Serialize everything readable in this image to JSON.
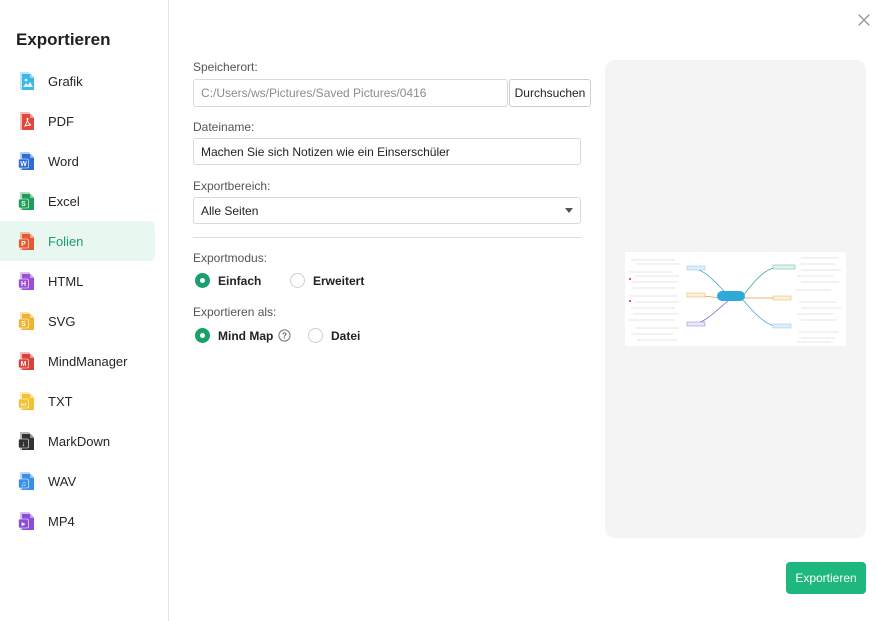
{
  "sidebar": {
    "title": "Exportieren",
    "items": [
      {
        "label": "Grafik",
        "icon": "image-file-icon",
        "color": "#3fb5e8",
        "letter": ""
      },
      {
        "label": "PDF",
        "icon": "pdf-file-icon",
        "color": "#e2453c",
        "letter": ""
      },
      {
        "label": "Word",
        "icon": "word-file-icon",
        "color": "#2f6bd6",
        "letter": "W"
      },
      {
        "label": "Excel",
        "icon": "excel-file-icon",
        "color": "#1f9d5a",
        "letter": "S"
      },
      {
        "label": "Folien",
        "icon": "slides-file-icon",
        "color": "#e8572e",
        "letter": "P"
      },
      {
        "label": "HTML",
        "icon": "html-file-icon",
        "color": "#9b4fd6",
        "letter": "H"
      },
      {
        "label": "SVG",
        "icon": "svg-file-icon",
        "color": "#f2b12e",
        "letter": "S"
      },
      {
        "label": "MindManager",
        "icon": "mindmanager-file-icon",
        "color": "#d9423b",
        "letter": "M"
      },
      {
        "label": "TXT",
        "icon": "txt-file-icon",
        "color": "#f2c230",
        "letter": "txt"
      },
      {
        "label": "MarkDown",
        "icon": "markdown-file-icon",
        "color": "#333333",
        "letter": "↓"
      },
      {
        "label": "WAV",
        "icon": "wav-file-icon",
        "color": "#3a8fe6",
        "letter": "♫"
      },
      {
        "label": "MP4",
        "icon": "mp4-file-icon",
        "color": "#8a4fd6",
        "letter": "▸"
      }
    ],
    "active_index": 4
  },
  "form": {
    "location_label": "Speicherort:",
    "location_value": "C:/Users/ws/Pictures/Saved Pictures/0416",
    "browse_label": "Durchsuchen",
    "filename_label": "Dateiname:",
    "filename_value": "Machen Sie sich Notizen wie ein Einserschüler",
    "range_label": "Exportbereich:",
    "range_value": "Alle Seiten",
    "mode_label": "Exportmodus:",
    "mode_options": [
      "Einfach",
      "Erweitert"
    ],
    "mode_selected": "Einfach",
    "as_label": "Exportieren als:",
    "as_options": [
      "Mind Map",
      "Datei"
    ],
    "as_selected": "Mind Map"
  },
  "export_button": "Exportieren",
  "colors": {
    "accent": "#1eb87f",
    "active_bg": "#e8f7ef"
  }
}
